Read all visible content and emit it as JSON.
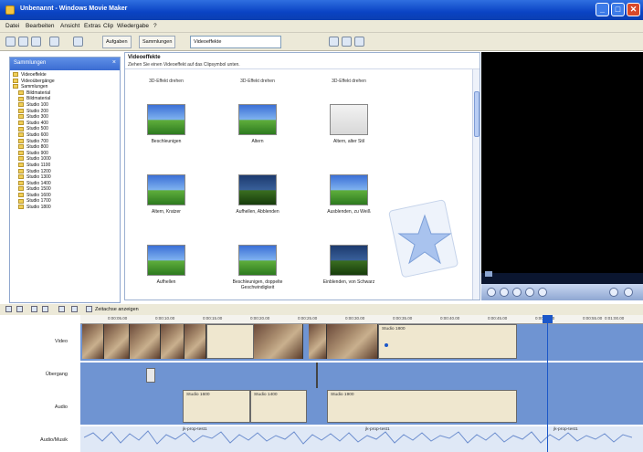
{
  "window": {
    "title": "Unbenannt - Windows Movie Maker",
    "buttons": [
      "_",
      "□",
      "✕"
    ]
  },
  "menu": [
    "Datei",
    "Bearbeiten",
    "Ansicht",
    "Extras",
    "Clip",
    "Wiedergabe",
    "?"
  ],
  "toolbar": {
    "tasks_label": "Aufgaben",
    "collections_label": "Sammlungen",
    "collection_combo": "Videoeffekte"
  },
  "left_pane": {
    "header": "Sammlungen",
    "items": [
      "Videoeffekte",
      "Videoübergänge",
      "Sammlungen",
      "Bildmaterial",
      "Bildmaterial",
      "Studio 100",
      "Studio 200",
      "Studio 300",
      "Studio 400",
      "Studio 500",
      "Studio 600",
      "Studio 700",
      "Studio 800",
      "Studio 900",
      "Studio 1000",
      "Studio 1100",
      "Studio 1200",
      "Studio 1300",
      "Studio 1400",
      "Studio 1500",
      "Studio 1600",
      "Studio 1700",
      "Studio 1800"
    ]
  },
  "content": {
    "title": "Videoeffekte",
    "subtitle": "Ziehen Sie einen Videoeffekt auf das Clipsymbol unten.",
    "categories": [
      "3D-Effekt drehen",
      "3D-Effekt drehen",
      "3D-Effekt drehen"
    ],
    "tiles": [
      {
        "label": "Beschleunigen",
        "style": "sky"
      },
      {
        "label": "Altern",
        "style": "sky"
      },
      {
        "label": "Altern, alter Stil",
        "style": "white"
      },
      {
        "label": "Altern, Kratzer",
        "style": "sky"
      },
      {
        "label": "Aufhellen, Abblenden",
        "style": "dark"
      },
      {
        "label": "Ausblenden, zu Weiß",
        "style": "sky"
      },
      {
        "label": "Aufhellen",
        "style": "sky"
      },
      {
        "label": "Beschleunigen, doppelte Geschwindigkeit",
        "style": "sky"
      },
      {
        "label": "Einblenden, von Schwarz",
        "style": "dark"
      }
    ]
  },
  "storyboard_toolbar": {
    "label": "Zeitachse anzeigen"
  },
  "ruler_ticks": [
    "0:00:05.00",
    "0:00:10.00",
    "0:00:15.00",
    "0:00:20.00",
    "0:00:25.00",
    "0:00:30.00",
    "0:00:35.00",
    "0:00:40.00",
    "0:00:45.00",
    "0:00:50.00",
    "0:00:55.00",
    "0:01:00.00"
  ],
  "timeline": {
    "rows": [
      "Video",
      "Übergang",
      "Audio",
      "Audio/Musik"
    ],
    "video_clip_label": "Studio 1800",
    "audio_clips": [
      "Studio 1600",
      "Studio 1400",
      "Studio 1900"
    ],
    "music_clips": [
      "jk-prop-test1",
      "jk-prop-test1",
      "jk-prop-test1"
    ]
  }
}
